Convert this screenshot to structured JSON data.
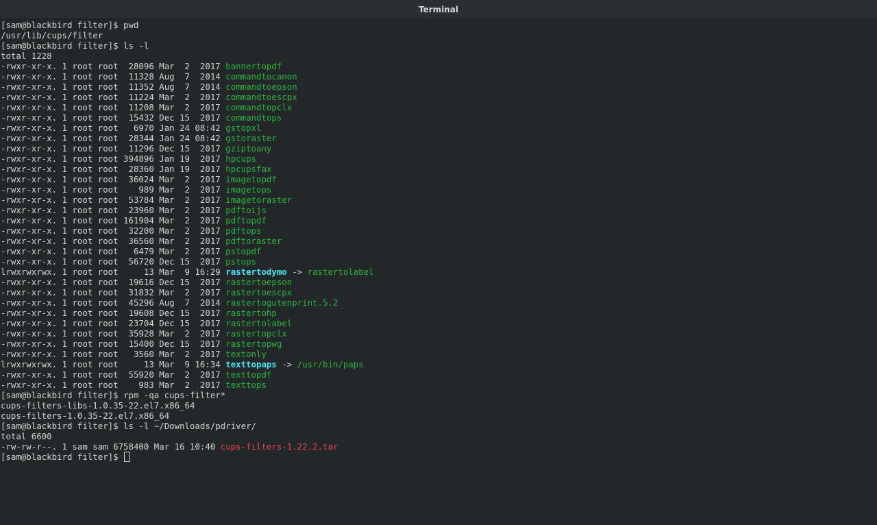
{
  "window": {
    "title": "Terminal"
  },
  "colors": {
    "background": "#232729",
    "text": "#d3d7cf",
    "exec_green": "#2bb43b",
    "symlink_cyan": "#4ee5f5",
    "archive_red": "#e8454b"
  },
  "terminal": {
    "lines": [
      {
        "parts": [
          {
            "t": "[sam@blackbird filter]$ pwd",
            "c": ""
          }
        ]
      },
      {
        "parts": [
          {
            "t": "/usr/lib/cups/filter",
            "c": ""
          }
        ]
      },
      {
        "parts": [
          {
            "t": "[sam@blackbird filter]$ ls -l",
            "c": ""
          }
        ]
      },
      {
        "parts": [
          {
            "t": "total 1228",
            "c": ""
          }
        ]
      },
      {
        "parts": [
          {
            "t": "-rwxr-xr-x. 1 root root  28096 Mar  2  2017 ",
            "c": ""
          },
          {
            "t": "bannertopdf",
            "c": "g"
          }
        ]
      },
      {
        "parts": [
          {
            "t": "-rwxr-xr-x. 1 root root  11328 Aug  7  2014 ",
            "c": ""
          },
          {
            "t": "commandtocanon",
            "c": "g"
          }
        ]
      },
      {
        "parts": [
          {
            "t": "-rwxr-xr-x. 1 root root  11352 Aug  7  2014 ",
            "c": ""
          },
          {
            "t": "commandtoepson",
            "c": "g"
          }
        ]
      },
      {
        "parts": [
          {
            "t": "-rwxr-xr-x. 1 root root  11224 Mar  2  2017 ",
            "c": ""
          },
          {
            "t": "commandtoescpx",
            "c": "g"
          }
        ]
      },
      {
        "parts": [
          {
            "t": "-rwxr-xr-x. 1 root root  11208 Mar  2  2017 ",
            "c": ""
          },
          {
            "t": "commandtopclx",
            "c": "g"
          }
        ]
      },
      {
        "parts": [
          {
            "t": "-rwxr-xr-x. 1 root root  15432 Dec 15  2017 ",
            "c": ""
          },
          {
            "t": "commandtops",
            "c": "g"
          }
        ]
      },
      {
        "parts": [
          {
            "t": "-rwxr-xr-x. 1 root root   6970 Jan 24 08:42 ",
            "c": ""
          },
          {
            "t": "gstopxl",
            "c": "g"
          }
        ]
      },
      {
        "parts": [
          {
            "t": "-rwxr-xr-x. 1 root root  28344 Jan 24 08:42 ",
            "c": ""
          },
          {
            "t": "gstoraster",
            "c": "g"
          }
        ]
      },
      {
        "parts": [
          {
            "t": "-rwxr-xr-x. 1 root root  11296 Dec 15  2017 ",
            "c": ""
          },
          {
            "t": "gziptoany",
            "c": "g"
          }
        ]
      },
      {
        "parts": [
          {
            "t": "-rwxr-xr-x. 1 root root 394896 Jan 19  2017 ",
            "c": ""
          },
          {
            "t": "hpcups",
            "c": "g"
          }
        ]
      },
      {
        "parts": [
          {
            "t": "-rwxr-xr-x. 1 root root  28360 Jan 19  2017 ",
            "c": ""
          },
          {
            "t": "hpcupsfax",
            "c": "g"
          }
        ]
      },
      {
        "parts": [
          {
            "t": "-rwxr-xr-x. 1 root root  36024 Mar  2  2017 ",
            "c": ""
          },
          {
            "t": "imagetopdf",
            "c": "g"
          }
        ]
      },
      {
        "parts": [
          {
            "t": "-rwxr-xr-x. 1 root root    989 Mar  2  2017 ",
            "c": ""
          },
          {
            "t": "imagetops",
            "c": "g"
          }
        ]
      },
      {
        "parts": [
          {
            "t": "-rwxr-xr-x. 1 root root  53784 Mar  2  2017 ",
            "c": ""
          },
          {
            "t": "imagetoraster",
            "c": "g"
          }
        ]
      },
      {
        "parts": [
          {
            "t": "-rwxr-xr-x. 1 root root  23960 Mar  2  2017 ",
            "c": ""
          },
          {
            "t": "pdftoijs",
            "c": "g"
          }
        ]
      },
      {
        "parts": [
          {
            "t": "-rwxr-xr-x. 1 root root 161904 Mar  2  2017 ",
            "c": ""
          },
          {
            "t": "pdftopdf",
            "c": "g"
          }
        ]
      },
      {
        "parts": [
          {
            "t": "-rwxr-xr-x. 1 root root  32200 Mar  2  2017 ",
            "c": ""
          },
          {
            "t": "pdftops",
            "c": "g"
          }
        ]
      },
      {
        "parts": [
          {
            "t": "-rwxr-xr-x. 1 root root  36560 Mar  2  2017 ",
            "c": ""
          },
          {
            "t": "pdftoraster",
            "c": "g"
          }
        ]
      },
      {
        "parts": [
          {
            "t": "-rwxr-xr-x. 1 root root   6479 Mar  2  2017 ",
            "c": ""
          },
          {
            "t": "pstopdf",
            "c": "g"
          }
        ]
      },
      {
        "parts": [
          {
            "t": "-rwxr-xr-x. 1 root root  56720 Dec 15  2017 ",
            "c": ""
          },
          {
            "t": "pstops",
            "c": "g"
          }
        ]
      },
      {
        "parts": [
          {
            "t": "lrwxrwxrwx. 1 root root     13 Mar  9 16:29 ",
            "c": ""
          },
          {
            "t": "rastertodymo",
            "c": "c"
          },
          {
            "t": " -> ",
            "c": ""
          },
          {
            "t": "rastertolabel",
            "c": "g"
          }
        ]
      },
      {
        "parts": [
          {
            "t": "-rwxr-xr-x. 1 root root  19616 Dec 15  2017 ",
            "c": ""
          },
          {
            "t": "rastertoepson",
            "c": "g"
          }
        ]
      },
      {
        "parts": [
          {
            "t": "-rwxr-xr-x. 1 root root  31832 Mar  2  2017 ",
            "c": ""
          },
          {
            "t": "rastertoescpx",
            "c": "g"
          }
        ]
      },
      {
        "parts": [
          {
            "t": "-rwxr-xr-x. 1 root root  45296 Aug  7  2014 ",
            "c": ""
          },
          {
            "t": "rastertogutenprint.5.2",
            "c": "g"
          }
        ]
      },
      {
        "parts": [
          {
            "t": "-rwxr-xr-x. 1 root root  19608 Dec 15  2017 ",
            "c": ""
          },
          {
            "t": "rastertohp",
            "c": "g"
          }
        ]
      },
      {
        "parts": [
          {
            "t": "-rwxr-xr-x. 1 root root  23704 Dec 15  2017 ",
            "c": ""
          },
          {
            "t": "rastertolabel",
            "c": "g"
          }
        ]
      },
      {
        "parts": [
          {
            "t": "-rwxr-xr-x. 1 root root  35928 Mar  2  2017 ",
            "c": ""
          },
          {
            "t": "rastertopclx",
            "c": "g"
          }
        ]
      },
      {
        "parts": [
          {
            "t": "-rwxr-xr-x. 1 root root  15400 Dec 15  2017 ",
            "c": ""
          },
          {
            "t": "rastertopwg",
            "c": "g"
          }
        ]
      },
      {
        "parts": [
          {
            "t": "-rwxr-xr-x. 1 root root   3560 Mar  2  2017 ",
            "c": ""
          },
          {
            "t": "textonly",
            "c": "g"
          }
        ]
      },
      {
        "parts": [
          {
            "t": "lrwxrwxrwx. 1 root root     13 Mar  9 16:34 ",
            "c": ""
          },
          {
            "t": "texttopaps",
            "c": "c"
          },
          {
            "t": " -> ",
            "c": ""
          },
          {
            "t": "/usr/bin/paps",
            "c": "g"
          }
        ]
      },
      {
        "parts": [
          {
            "t": "-rwxr-xr-x. 1 root root  55920 Mar  2  2017 ",
            "c": ""
          },
          {
            "t": "texttopdf",
            "c": "g"
          }
        ]
      },
      {
        "parts": [
          {
            "t": "-rwxr-xr-x. 1 root root    983 Mar  2  2017 ",
            "c": ""
          },
          {
            "t": "texttops",
            "c": "g"
          }
        ]
      },
      {
        "parts": [
          {
            "t": "[sam@blackbird filter]$ rpm -qa cups-filter*",
            "c": ""
          }
        ]
      },
      {
        "parts": [
          {
            "t": "cups-filters-libs-1.0.35-22.el7.x86_64",
            "c": ""
          }
        ]
      },
      {
        "parts": [
          {
            "t": "cups-filters-1.0.35-22.el7.x86_64",
            "c": ""
          }
        ]
      },
      {
        "parts": [
          {
            "t": "[sam@blackbird filter]$ ls -l ~/Downloads/pdriver/",
            "c": ""
          }
        ]
      },
      {
        "parts": [
          {
            "t": "total 6600",
            "c": ""
          }
        ]
      },
      {
        "parts": [
          {
            "t": "-rw-rw-r--. 1 sam sam 6758400 Mar 16 10:40 ",
            "c": ""
          },
          {
            "t": "cups-filters-1.22.2.tar",
            "c": "r"
          }
        ]
      }
    ],
    "prompt": "[sam@blackbird filter]$ "
  }
}
